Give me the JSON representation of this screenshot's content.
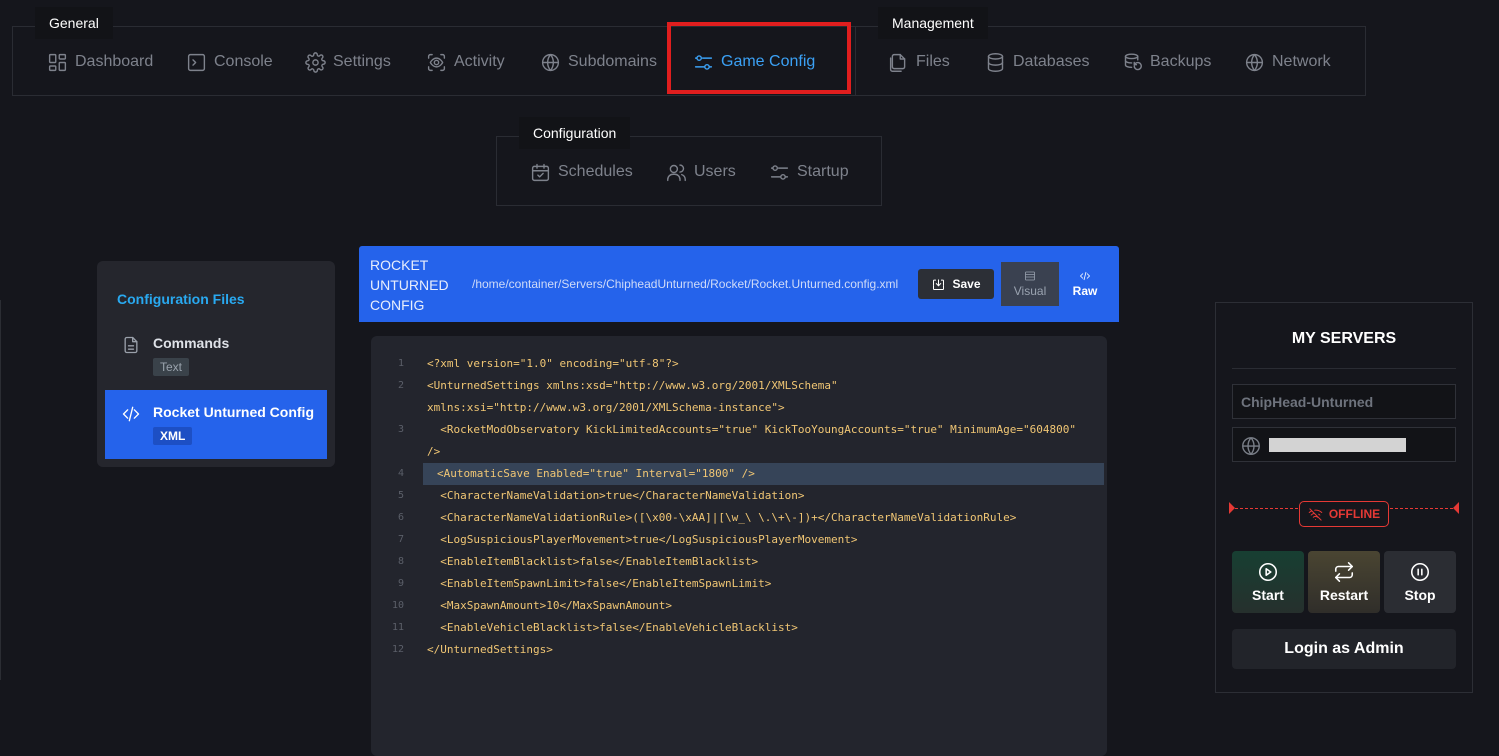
{
  "nav": {
    "general": {
      "label": "General",
      "items": [
        {
          "label": "Dashboard",
          "icon": "dashboard-icon"
        },
        {
          "label": "Console",
          "icon": "terminal-icon"
        },
        {
          "label": "Settings",
          "icon": "gear-icon"
        },
        {
          "label": "Activity",
          "icon": "eye-scan-icon"
        },
        {
          "label": "Subdomains",
          "icon": "globe-icon"
        },
        {
          "label": "Game Config",
          "icon": "sliders-icon",
          "active": true
        }
      ]
    },
    "management": {
      "label": "Management",
      "items": [
        {
          "label": "Files",
          "icon": "files-icon"
        },
        {
          "label": "Databases",
          "icon": "database-icon"
        },
        {
          "label": "Backups",
          "icon": "backup-icon"
        },
        {
          "label": "Network",
          "icon": "globe-icon"
        }
      ]
    },
    "configuration": {
      "label": "Configuration",
      "items": [
        {
          "label": "Schedules",
          "icon": "calendar-check-icon"
        },
        {
          "label": "Users",
          "icon": "users-icon"
        },
        {
          "label": "Startup",
          "icon": "sliders-icon"
        }
      ]
    }
  },
  "config_files": {
    "title": "Configuration Files",
    "items": [
      {
        "name": "Commands",
        "badge": "Text",
        "icon": "document-icon"
      },
      {
        "name": "Rocket Unturned Config",
        "badge": "XML",
        "icon": "code-icon",
        "active": true
      }
    ]
  },
  "editor": {
    "title": "ROCKET UNTURNED CONFIG",
    "path": "/home/container/Servers/ChipheadUnturned/Rocket/Rocket.Unturned.config.xml",
    "save_label": "Save",
    "visual_label": "Visual",
    "raw_label": "Raw",
    "lines": [
      {
        "n": "1",
        "text": "<?xml version=\"1.0\" encoding=\"utf-8\"?>"
      },
      {
        "n": "2",
        "text": "<UnturnedSettings xmlns:xsd=\"http://www.w3.org/2001/XMLSchema\""
      },
      {
        "n": "",
        "text": "xmlns:xsi=\"http://www.w3.org/2001/XMLSchema-instance\">"
      },
      {
        "n": "3",
        "text": "  <RocketModObservatory KickLimitedAccounts=\"true\" KickTooYoungAccounts=\"true\" MinimumAge=\"604800\""
      },
      {
        "n": "",
        "text": "/>"
      },
      {
        "n": "4",
        "text": "<AutomaticSave Enabled=\"true\" Interval=\"1800\" />",
        "highlight": true
      },
      {
        "n": "5",
        "text": "  <CharacterNameValidation>true</CharacterNameValidation>"
      },
      {
        "n": "6",
        "text": "  <CharacterNameValidationRule>([\\x00-\\xAA]|[\\w_\\ \\.\\+\\-])+</CharacterNameValidationRule>"
      },
      {
        "n": "7",
        "text": "  <LogSuspiciousPlayerMovement>true</LogSuspiciousPlayerMovement>"
      },
      {
        "n": "8",
        "text": "  <EnableItemBlacklist>false</EnableItemBlacklist>"
      },
      {
        "n": "9",
        "text": "  <EnableItemSpawnLimit>false</EnableItemSpawnLimit>"
      },
      {
        "n": "10",
        "text": "  <MaxSpawnAmount>10</MaxSpawnAmount>"
      },
      {
        "n": "11",
        "text": "  <EnableVehicleBlacklist>false</EnableVehicleBlacklist>"
      },
      {
        "n": "12",
        "text": "</UnturnedSettings>"
      }
    ]
  },
  "servers": {
    "title": "MY SERVERS",
    "server_name": "ChipHead-Unturned",
    "status": "OFFLINE",
    "status_color": "#e53935",
    "start_label": "Start",
    "restart_label": "Restart",
    "stop_label": "Stop",
    "login_label": "Login as Admin"
  },
  "colors": {
    "accent": "#2563eb",
    "active_nav": "#3ba1f5",
    "highlight_box": "#e01e1e"
  }
}
